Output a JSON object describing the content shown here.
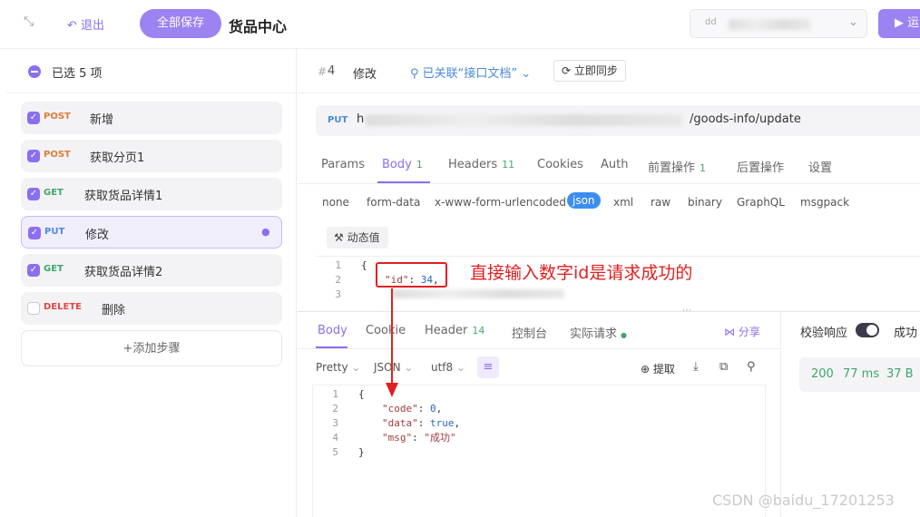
{
  "topbar": {
    "exit_label": "退出",
    "save_all_label": "全部保存",
    "title": "货品中心",
    "env_prefix": "dd",
    "run_label": "运"
  },
  "steps_panel": {
    "selected_label": "已选 5 项",
    "steps": [
      {
        "method": "POST",
        "name": "新增",
        "checked": true
      },
      {
        "method": "POST",
        "name": "获取分页1",
        "checked": true
      },
      {
        "method": "GET",
        "name": "获取货品详情1",
        "checked": true
      },
      {
        "method": "PUT",
        "name": "修改",
        "checked": true,
        "active": true
      },
      {
        "method": "GET",
        "name": "获取货品详情2",
        "checked": true
      },
      {
        "method": "DELETE",
        "name": "删除",
        "checked": false
      }
    ],
    "add_step_label": "+添加步骤"
  },
  "request": {
    "step_id": "4",
    "step_name": "修改",
    "linked_label": "已关联“接口文档”",
    "sync_label": "立即同步",
    "method": "PUT",
    "url_prefix": "h",
    "url_suffix": "/goods-info/update",
    "tabs": [
      {
        "label": "Params"
      },
      {
        "label": "Body",
        "count": "1",
        "active": true
      },
      {
        "label": "Headers",
        "count": "11"
      },
      {
        "label": "Cookies"
      },
      {
        "label": "Auth"
      },
      {
        "label": "前置操作",
        "count": "1"
      },
      {
        "label": "后置操作"
      },
      {
        "label": "设置"
      }
    ],
    "body_formats": [
      "none",
      "form-data",
      "x-www-form-urlencoded",
      "json",
      "xml",
      "raw",
      "binary",
      "GraphQL",
      "msgpack"
    ],
    "active_format": "json",
    "dynamic_value_label": "动态值",
    "body_lines": [
      "{",
      "\"id\": 34,",
      "",
      ""
    ],
    "line_numbers": [
      "1",
      "2",
      "3"
    ]
  },
  "annotation": "直接输入数字id是请求成功的",
  "response": {
    "tabs": [
      {
        "label": "Body",
        "active": true
      },
      {
        "label": "Cookie"
      },
      {
        "label": "Header",
        "count": "14"
      },
      {
        "label": "控制台"
      },
      {
        "label": "实际请求"
      }
    ],
    "share_label": "分享",
    "view_mode": "Pretty",
    "lang": "JSON",
    "encoding": "utf8",
    "extract_label": "提取",
    "line_numbers": [
      "1",
      "2",
      "3",
      "4",
      "5"
    ],
    "code": {
      "open": "{",
      "code_key": "\"code\"",
      "code_val": "0",
      "data_key": "\"data\"",
      "data_val": "true",
      "msg_key": "\"msg\"",
      "msg_val": "\"成功\"",
      "close": "}"
    },
    "validate_label": "校验响应",
    "success_label": "成功",
    "status": "200",
    "time": "77 ms",
    "size": "37 B"
  },
  "watermark": "CSDN @baidu_17201253"
}
